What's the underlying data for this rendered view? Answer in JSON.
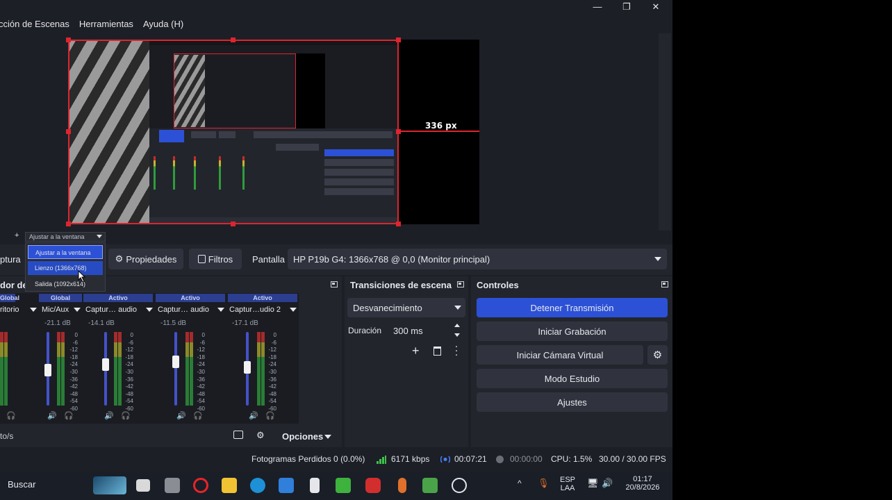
{
  "window": {
    "minimize": "—",
    "maximize": "❐",
    "close": "✕"
  },
  "menu": [
    "cción de Escenas",
    "Herramientas",
    "Ayuda (H)"
  ],
  "preview": {
    "measure_label": "336 px"
  },
  "zoom": {
    "selected": "Ajustar a la ventana",
    "options": [
      "Ajustar a la ventana",
      "Lienzo (1366x768)",
      "Salida (1092x614)"
    ]
  },
  "source_toolbar": {
    "capture_label": "ptura",
    "properties_label": "Propiedades",
    "filters_label": "Filtros",
    "screen_label": "Pantalla",
    "screen_value": "HP P19b G4: 1366x768 @ 0,0 (Monitor principal)"
  },
  "mixer": {
    "title": "dor de",
    "channels": [
      {
        "head": "Global",
        "name": "ritorio",
        "db": "",
        "level": 0.58
      },
      {
        "head": "Global",
        "name": "Mic/Aux",
        "db": "-21.1 dB",
        "level": 0.52
      },
      {
        "head": "Activo",
        "name": "Captur… audio",
        "db": "-14.1 dB",
        "level": 0.6
      },
      {
        "head": "Activo",
        "name": "Captur… audio",
        "db": "-11.5 dB",
        "level": 0.62
      },
      {
        "head": "Activo",
        "name": "Captur…udio 2",
        "db": "-17.1 dB",
        "level": 0.55
      }
    ],
    "scale": [
      "0",
      "-6",
      "-12",
      "-18",
      "-24",
      "-30",
      "-36",
      "-42",
      "-48",
      "-54",
      "-60"
    ],
    "footer_left": "to/s",
    "options_label": "Opciones"
  },
  "transitions": {
    "title": "Transiciones de escena",
    "type": "Desvanecimiento",
    "duration_label": "Duración",
    "duration_value": "300 ms"
  },
  "controls": {
    "title": "Controles",
    "stop_stream": "Detener Transmisión",
    "start_recording": "Iniciar Grabación",
    "virtual_cam": "Iniciar Cámara Virtual",
    "studio_mode": "Modo Estudio",
    "settings": "Ajustes"
  },
  "status": {
    "dropped_frames": "Fotogramas Perdidos 0 (0.0%)",
    "bitrate": "6171 kbps",
    "stream_time": "00:07:21",
    "rec_time": "00:00:00",
    "cpu": "CPU: 1.5%",
    "fps": "30.00 / 30.00 FPS"
  },
  "taskbar": {
    "search": "Buscar",
    "lang_top": "ESP",
    "lang_bottom": "LAA",
    "time": "01:17",
    "date": "20/8/2026"
  },
  "colors": {
    "accent": "#2c51d6",
    "selection": "#e0242e",
    "panel": "#23252d",
    "background": "#1d1f26"
  }
}
